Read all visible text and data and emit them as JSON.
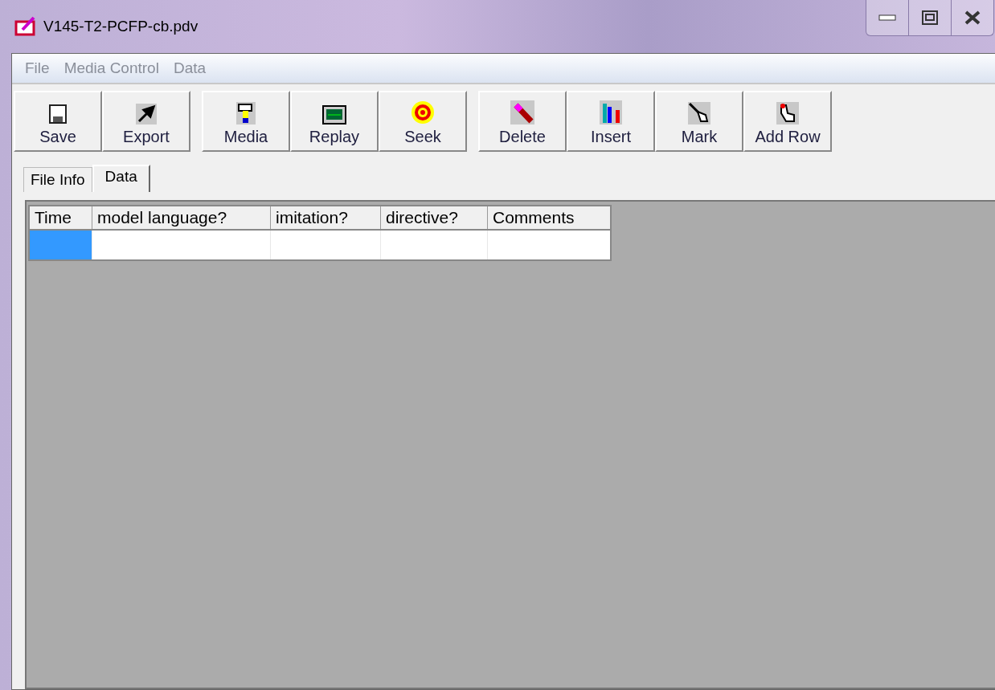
{
  "window": {
    "title": "V145-T2-PCFP-cb.pdv"
  },
  "menu": [
    {
      "label": "File",
      "disabled": true
    },
    {
      "label": "Media Control",
      "disabled": true
    },
    {
      "label": "Data",
      "disabled": true
    }
  ],
  "toolbar": [
    [
      {
        "label": "Save",
        "kind": "save"
      },
      {
        "label": "Export",
        "kind": "export"
      }
    ],
    [
      {
        "label": "Media",
        "kind": "media"
      },
      {
        "label": "Replay",
        "kind": "replay"
      },
      {
        "label": "Seek",
        "kind": "seek"
      }
    ],
    [
      {
        "label": "Delete",
        "kind": "delete"
      },
      {
        "label": "Insert",
        "kind": "insert"
      },
      {
        "label": "Mark",
        "kind": "mark"
      },
      {
        "label": "Add Row",
        "kind": "addrow"
      }
    ]
  ],
  "tabs": [
    {
      "label": "File Info",
      "selected": false
    },
    {
      "label": "Data",
      "selected": true
    }
  ],
  "table": {
    "columns": [
      "Time",
      "model language?",
      "imitation?",
      "directive?",
      "Comments"
    ],
    "rows": [
      {
        "cells": [
          {
            "selected": true
          },
          {
            "selected": false
          },
          {
            "selected": false
          },
          {
            "selected": false
          },
          {
            "selected": false
          }
        ]
      }
    ]
  }
}
